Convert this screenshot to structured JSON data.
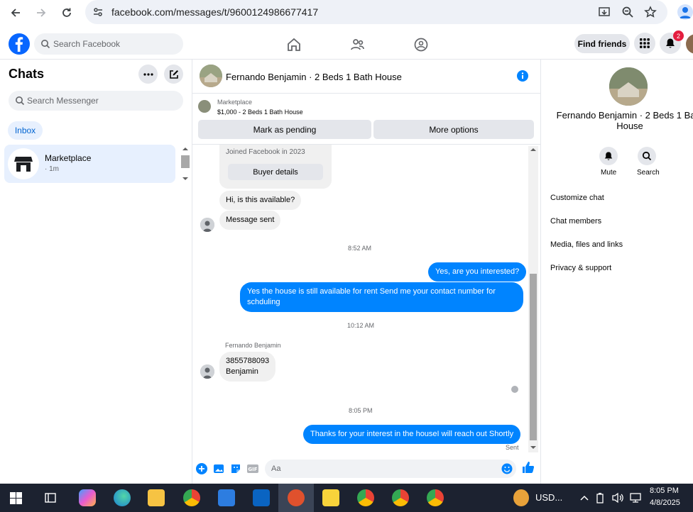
{
  "browser": {
    "url": "facebook.com/messages/t/9600124986677417"
  },
  "facebook": {
    "search_placeholder": "Search Facebook",
    "find_friends_label": "Find friends",
    "notification_count": "2"
  },
  "left_pane": {
    "title": "Chats",
    "search_placeholder": "Search Messenger",
    "inbox_tab": "Inbox",
    "chat_item": {
      "name": "Marketplace",
      "time": "· 1m"
    }
  },
  "conversation": {
    "title": "Fernando Benjamin · 2 Beds 1 Bath House",
    "marketplace_label": "Marketplace",
    "listing": "$1,000 - 2 Beds 1 Bath House",
    "mark_pending": "Mark as pending",
    "more_options": "More options",
    "joined_text": "Joined Facebook in 2023",
    "buyer_details": "Buyer details",
    "msg_available": "Hi, is this available?",
    "msg_sent_notice": "Message sent",
    "ts_1": "8:52 AM",
    "out_1": "Yes, are you interested?",
    "out_2_line1": "Yes the house is still available for rent Send me your contact number for",
    "out_2_line2": "schduling",
    "ts_2": "10:12 AM",
    "sender_name": "Fernando Benjamin",
    "in_line1": "3855788093",
    "in_line2": "Benjamin",
    "ts_3": "8:05 PM",
    "out_3": "Thanks for your interest in the houseI will reach out Shortly",
    "sent_status": "Sent",
    "composer_placeholder": "Aa"
  },
  "right_pane": {
    "name_line1": "Fernando Benjamin · 2 Beds 1 Bath",
    "name_line2": "House",
    "mute_label": "Mute",
    "search_label": "Search",
    "menu": [
      "Customize chat",
      "Chat members",
      "Media, files and links",
      "Privacy & support"
    ]
  },
  "taskbar": {
    "tray_text": "USD...",
    "time": "8:05 PM",
    "date": "4/8/2025"
  },
  "colors": {
    "accent": "#0084ff",
    "fb_blue": "#0866ff",
    "taskbar": "#1c2230"
  }
}
